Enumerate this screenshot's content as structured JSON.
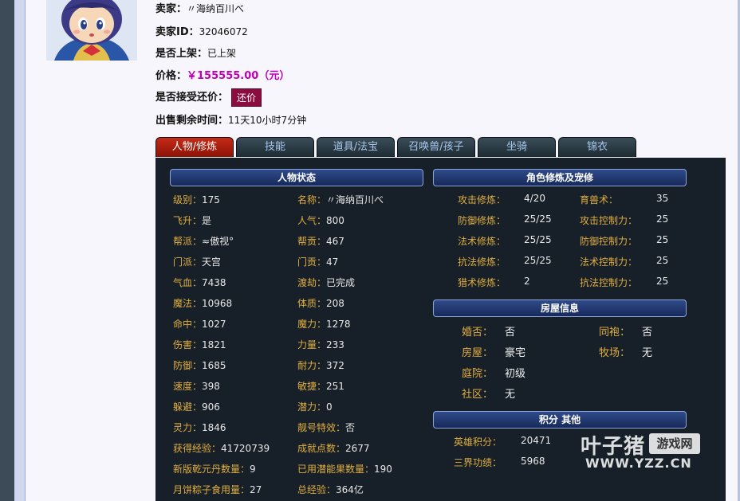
{
  "seller": {
    "name_label": "卖家：",
    "name_value": "〃海纳百川べ",
    "id_label": "卖家ID：",
    "id_value": "32046072",
    "listed_label": "是否上架：",
    "listed_value": "已上架",
    "price_label": "价格：",
    "price_value": "￥155555.00（元）",
    "bargain_label": "是否接受还价：",
    "bargain_button": "还价",
    "time_label": "出售剩余时间：",
    "time_value": "11天10小时7分钟"
  },
  "tabs": [
    "人物/修炼",
    "技能",
    "道具/法宝",
    "召唤兽/孩子",
    "坐骑",
    "锦衣"
  ],
  "active_tab": 0,
  "status": {
    "title": "人物状态",
    "left": [
      {
        "label": "级别：",
        "value": "175"
      },
      {
        "label": "飞升：",
        "value": "是"
      },
      {
        "label": "帮派：",
        "value": "≈傲视°"
      },
      {
        "label": "门派：",
        "value": "天宫"
      },
      {
        "label": "气血：",
        "value": "7438"
      },
      {
        "label": "魔法：",
        "value": "10968"
      },
      {
        "label": "命中：",
        "value": "1027"
      },
      {
        "label": "伤害：",
        "value": "1821"
      },
      {
        "label": "防御：",
        "value": "1685"
      },
      {
        "label": "速度：",
        "value": "398"
      },
      {
        "label": "躲避：",
        "value": "906"
      },
      {
        "label": "灵力：",
        "value": "1846"
      },
      {
        "label": "获得经验：",
        "value": "41720739"
      },
      {
        "label": "新版乾元丹数量：",
        "value": "9"
      },
      {
        "label": "月饼粽子食用量：",
        "value": "27"
      }
    ],
    "right": [
      {
        "label": "名称：",
        "value": "〃海纳百川べ"
      },
      {
        "label": "人气：",
        "value": "800"
      },
      {
        "label": "帮贡：",
        "value": "467"
      },
      {
        "label": "门贡：",
        "value": "47"
      },
      {
        "label": "渡劫：",
        "value": "已完成"
      },
      {
        "label": "体质：",
        "value": "208"
      },
      {
        "label": "魔力：",
        "value": "1278"
      },
      {
        "label": "力量：",
        "value": "233"
      },
      {
        "label": "耐力：",
        "value": "372"
      },
      {
        "label": "敏捷：",
        "value": "251"
      },
      {
        "label": "潜力：",
        "value": "0"
      },
      {
        "label": "靓号特效：",
        "value": "否"
      },
      {
        "label": "成就点数：",
        "value": "2677"
      },
      {
        "label": "已用潜能果数量：",
        "value": "190"
      },
      {
        "label": "总经验：",
        "value": "364亿"
      }
    ]
  },
  "cultivation": {
    "title": "角色修炼及宠修",
    "left": [
      {
        "label": "攻击修炼：",
        "value": "4/20"
      },
      {
        "label": "防御修炼：",
        "value": "25/25"
      },
      {
        "label": "法术修炼：",
        "value": "25/25"
      },
      {
        "label": "抗法修炼：",
        "value": "25/25"
      },
      {
        "label": "猎术修炼：",
        "value": "2"
      }
    ],
    "right": [
      {
        "label": "育兽术：",
        "value": "35"
      },
      {
        "label": "攻击控制力：",
        "value": "25"
      },
      {
        "label": "防御控制力：",
        "value": "25"
      },
      {
        "label": "法术控制力：",
        "value": "25"
      },
      {
        "label": "抗法控制力：",
        "value": "25"
      }
    ]
  },
  "house": {
    "title": "房屋信息",
    "rows": [
      {
        "label": "婚否：",
        "value": "否",
        "label2": "同袍：",
        "value2": "否"
      },
      {
        "label": "房屋：",
        "value": "豪宅",
        "label2": "牧场：",
        "value2": "无"
      },
      {
        "label": "庭院：",
        "value": "初级"
      },
      {
        "label": "社区：",
        "value": "无"
      }
    ]
  },
  "points": {
    "title": "积分 其他",
    "rows": [
      {
        "label": "英雄积分：",
        "value": "20471"
      },
      {
        "label": "三界功绩：",
        "value": "5968"
      }
    ]
  },
  "watermark": {
    "brand": "叶子猪",
    "tag": "游戏网",
    "url": "WWW.YZZ.CN"
  },
  "colors": {
    "price": "#c000b8",
    "bargain_button": "#8a0d3e",
    "panel_bg": "#172028",
    "label_gold": "#e0ae40",
    "active_tab": "#b01e10",
    "section_header": "#2f4b8a"
  }
}
